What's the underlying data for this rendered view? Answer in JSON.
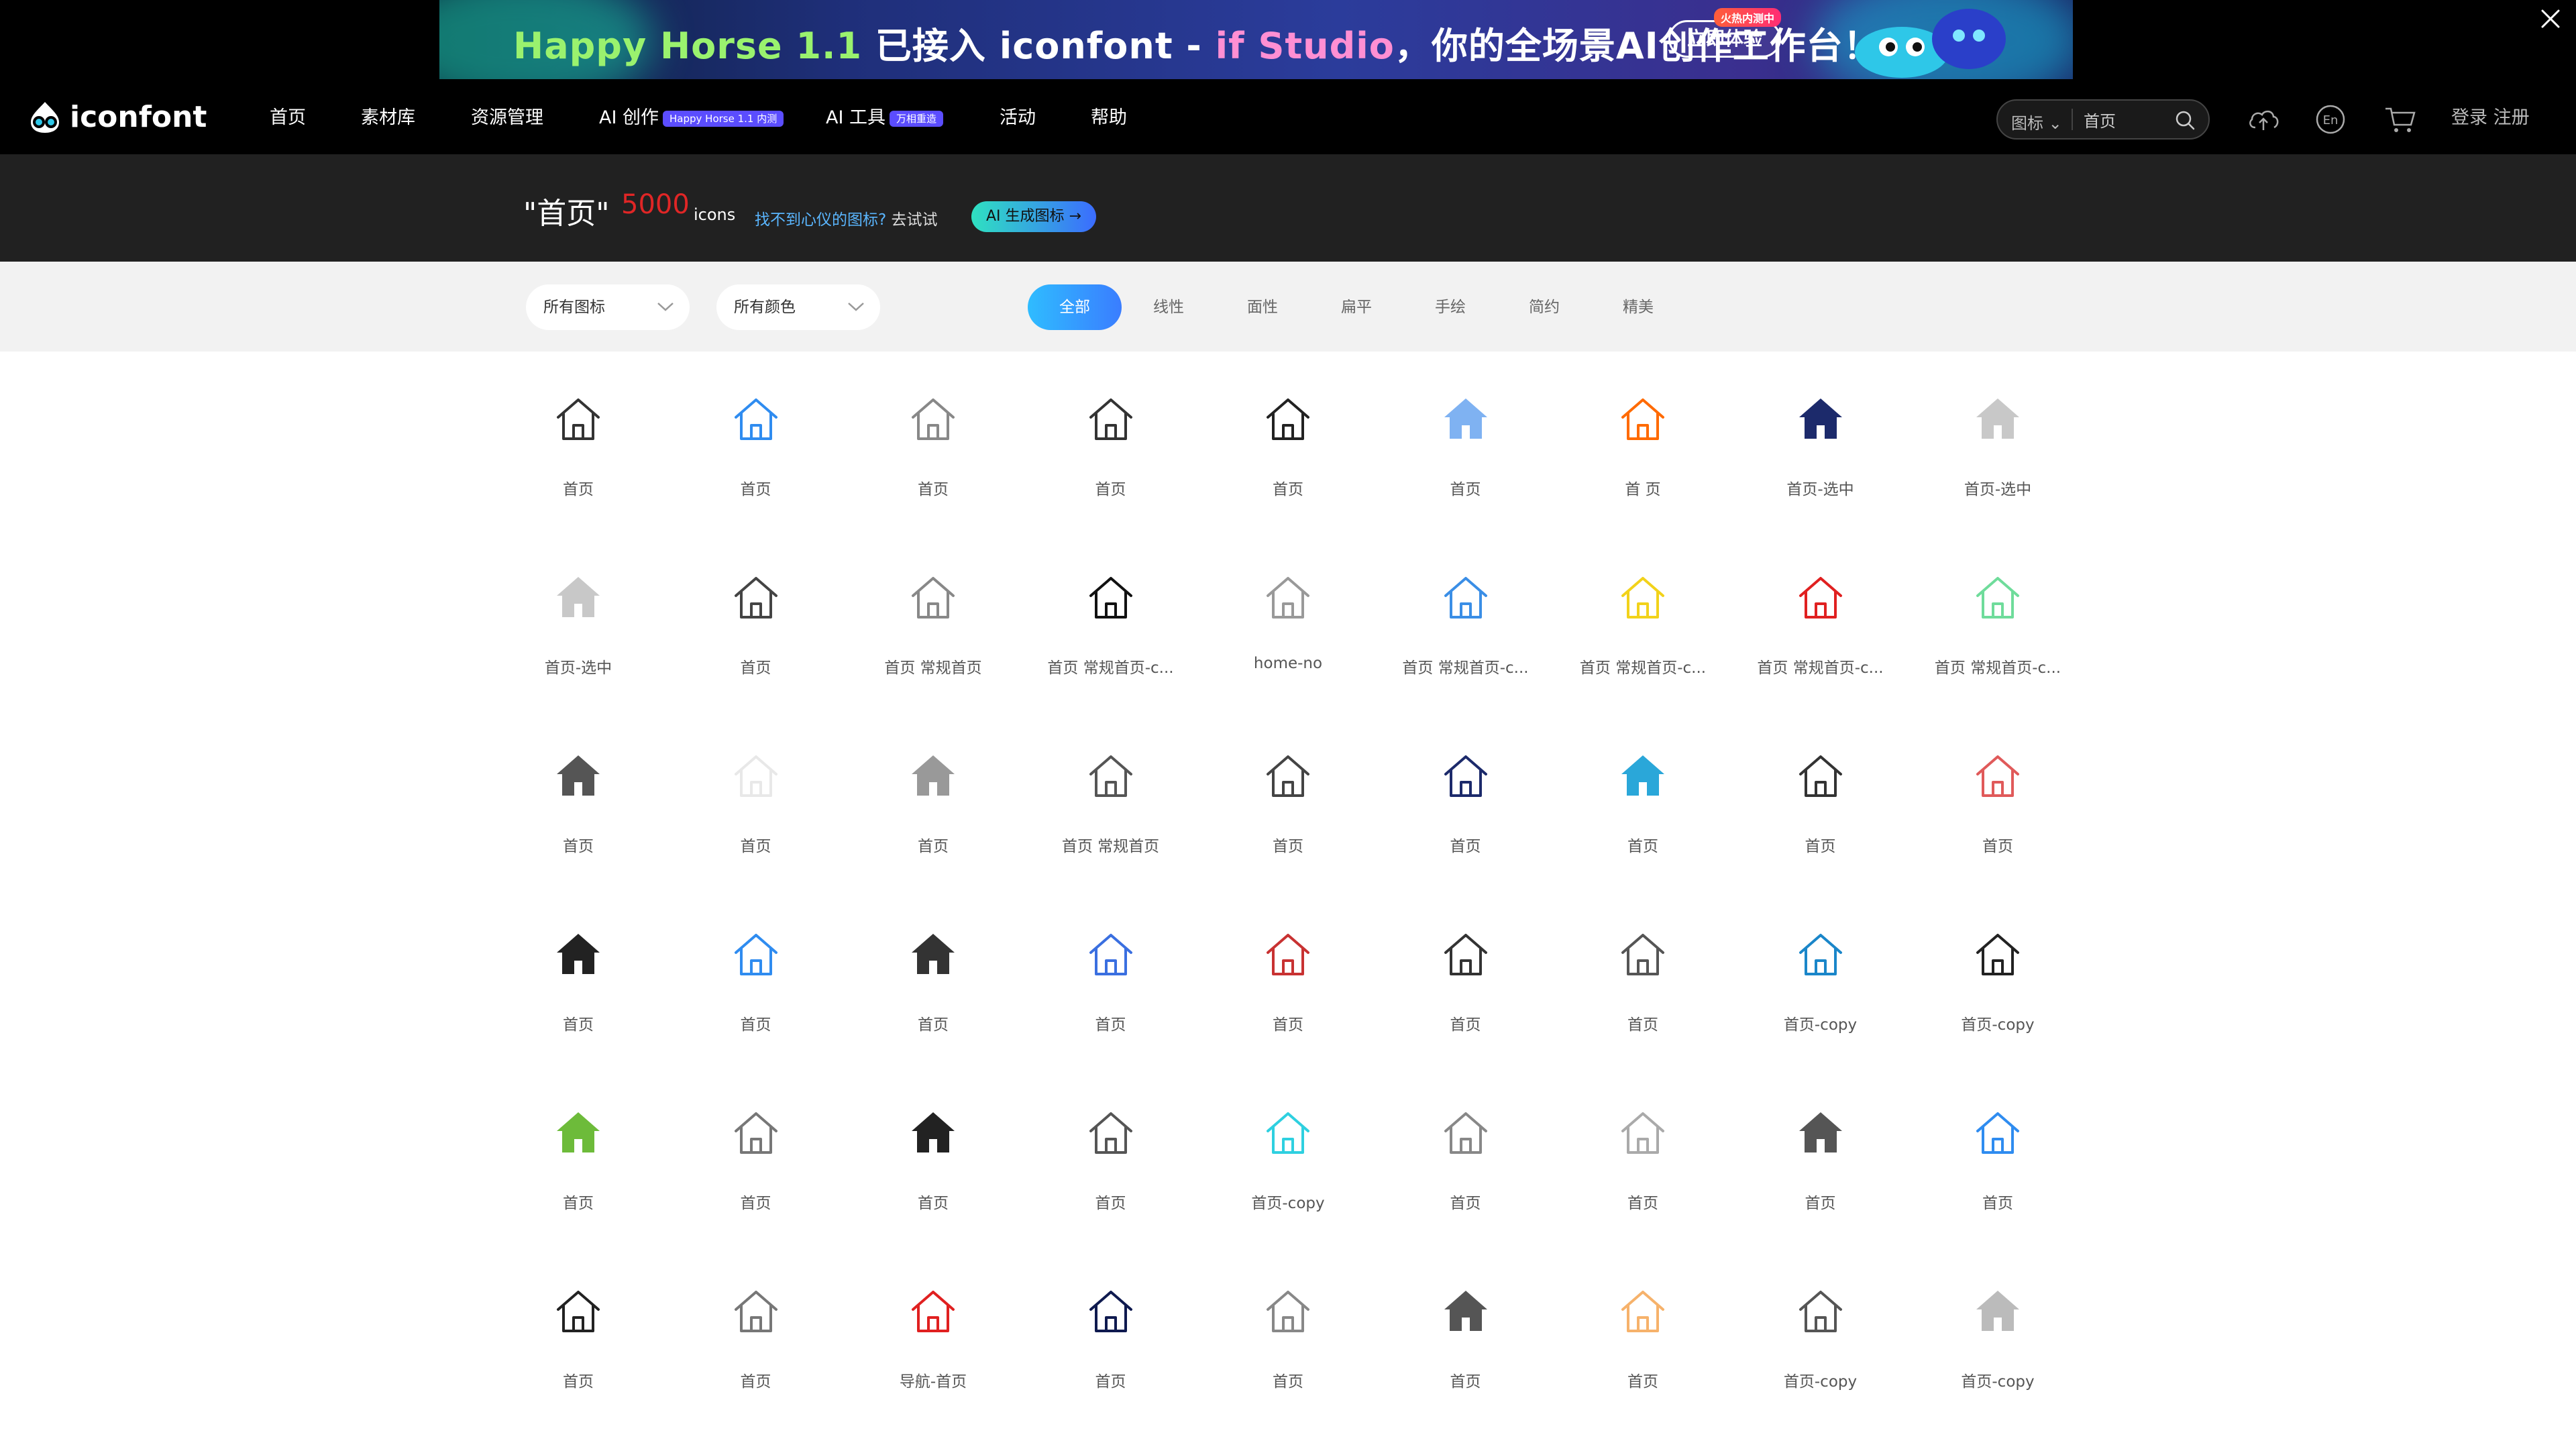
{
  "banner": {
    "part1": "Happy Horse",
    "version": "1.1",
    "part2": " 已接入 iconfont - ",
    "part3": "if Studio",
    "part4": "，你的全场景AI创作工作台！",
    "button": "立即体验",
    "badge": "火热内测中"
  },
  "nav": {
    "logo": "iconfont",
    "items": [
      {
        "label": "首页"
      },
      {
        "label": "素材库"
      },
      {
        "label": "资源管理"
      },
      {
        "label": "AI 创作",
        "tag": "Happy Horse 1.1 内测"
      },
      {
        "label": "AI 工具",
        "tag": "万相重造"
      },
      {
        "label": "活动"
      },
      {
        "label": "帮助"
      }
    ],
    "search_type": "图标",
    "search_value": "首页",
    "auth": "登录  注册"
  },
  "result": {
    "title": "\"首页\"",
    "count": "5000",
    "unit": "icons",
    "hint_link": "找不到心仪的图标?",
    "hint_rest": " 去试试",
    "ai_button": "AI 生成图标 →"
  },
  "filters": {
    "icon_select": "所有图标",
    "color_select": "所有颜色",
    "tabs": [
      "全部",
      "线性",
      "面性",
      "扁平",
      "手绘",
      "简约",
      "精美"
    ],
    "active_tab": "全部"
  },
  "icons": [
    {
      "label": "首页",
      "style": "outline",
      "color": "#333333"
    },
    {
      "label": "首页",
      "style": "outline",
      "color": "#2f8cf0"
    },
    {
      "label": "首页",
      "style": "outline",
      "color": "#888888"
    },
    {
      "label": "首页",
      "style": "outline",
      "color": "#333333"
    },
    {
      "label": "首页",
      "style": "outline",
      "color": "#222222"
    },
    {
      "label": "首页",
      "style": "fill",
      "color": "#7fb2f2"
    },
    {
      "label": "首 页",
      "style": "outline",
      "color": "#ff6a00"
    },
    {
      "label": "首页-选中",
      "style": "fill",
      "color": "#1c2a6b"
    },
    {
      "label": "首页-选中",
      "style": "fill",
      "color": "#c8c8c8"
    },
    {
      "label": "首页-选中",
      "style": "fill",
      "color": "#c8c8c8"
    },
    {
      "label": "首页",
      "style": "outline",
      "color": "#444444"
    },
    {
      "label": "首页 常规首页",
      "style": "outline",
      "color": "#888888"
    },
    {
      "label": "首页 常规首页-c...",
      "style": "outline",
      "color": "#111111"
    },
    {
      "label": "home-no",
      "style": "outline",
      "color": "#999999"
    },
    {
      "label": "首页 常规首页-c...",
      "style": "outline",
      "color": "#3a8ee6"
    },
    {
      "label": "首页 常规首页-c...",
      "style": "outline",
      "color": "#f2d21a"
    },
    {
      "label": "首页 常规首页-c...",
      "style": "outline",
      "color": "#e02020"
    },
    {
      "label": "首页 常规首页-c...",
      "style": "outline",
      "color": "#6fdc9b"
    },
    {
      "label": "首页",
      "style": "fill",
      "color": "#555555"
    },
    {
      "label": "首页",
      "style": "outline",
      "color": "#e8e8e8"
    },
    {
      "label": "首页",
      "style": "fill",
      "color": "#999999"
    },
    {
      "label": "首页 常规首页",
      "style": "outline",
      "color": "#555555"
    },
    {
      "label": "首页",
      "style": "outline",
      "color": "#444444"
    },
    {
      "label": "首页",
      "style": "outline",
      "color": "#1c2a6b"
    },
    {
      "label": "首页",
      "style": "fill",
      "color": "#2aa7d9"
    },
    {
      "label": "首页",
      "style": "outline",
      "color": "#333333"
    },
    {
      "label": "首页",
      "style": "outline",
      "color": "#e05a5a"
    },
    {
      "label": "首页",
      "style": "fill",
      "color": "#222222"
    },
    {
      "label": "首页",
      "style": "outline",
      "color": "#2f8cf0"
    },
    {
      "label": "首页",
      "style": "fill",
      "color": "#333333"
    },
    {
      "label": "首页",
      "style": "outline",
      "color": "#3a6fe0"
    },
    {
      "label": "首页",
      "style": "outline",
      "color": "#c83232"
    },
    {
      "label": "首页",
      "style": "outline",
      "color": "#333333"
    },
    {
      "label": "首页",
      "style": "outline",
      "color": "#555555"
    },
    {
      "label": "首页-copy",
      "style": "outline",
      "color": "#1a86c9"
    },
    {
      "label": "首页-copy",
      "style": "outline",
      "color": "#222222"
    },
    {
      "label": "首页",
      "style": "fill",
      "color": "#6dbb3a"
    },
    {
      "label": "首页",
      "style": "outline",
      "color": "#777777"
    },
    {
      "label": "首页",
      "style": "fill",
      "color": "#222222"
    },
    {
      "label": "首页",
      "style": "outline",
      "color": "#555555"
    },
    {
      "label": "首页-copy",
      "style": "outline",
      "color": "#2ed0e0"
    },
    {
      "label": "首页",
      "style": "outline",
      "color": "#888888"
    },
    {
      "label": "首页",
      "style": "outline",
      "color": "#aaaaaa"
    },
    {
      "label": "首页",
      "style": "fill",
      "color": "#555555"
    },
    {
      "label": "首页",
      "style": "outline",
      "color": "#2f8cf0"
    },
    {
      "label": "首页",
      "style": "outline",
      "color": "#222222"
    },
    {
      "label": "首页",
      "style": "outline",
      "color": "#777777"
    },
    {
      "label": "导航-首页",
      "style": "outline",
      "color": "#e02020"
    },
    {
      "label": "首页",
      "style": "outline",
      "color": "#0f1a4f"
    },
    {
      "label": "首页",
      "style": "outline",
      "color": "#888888"
    },
    {
      "label": "首页",
      "style": "fill",
      "color": "#555555"
    },
    {
      "label": "首页",
      "style": "outline",
      "color": "#f6b26b"
    },
    {
      "label": "首页-copy",
      "style": "outline",
      "color": "#555555"
    },
    {
      "label": "首页-copy",
      "style": "fill",
      "color": "#bbbbbb"
    }
  ]
}
